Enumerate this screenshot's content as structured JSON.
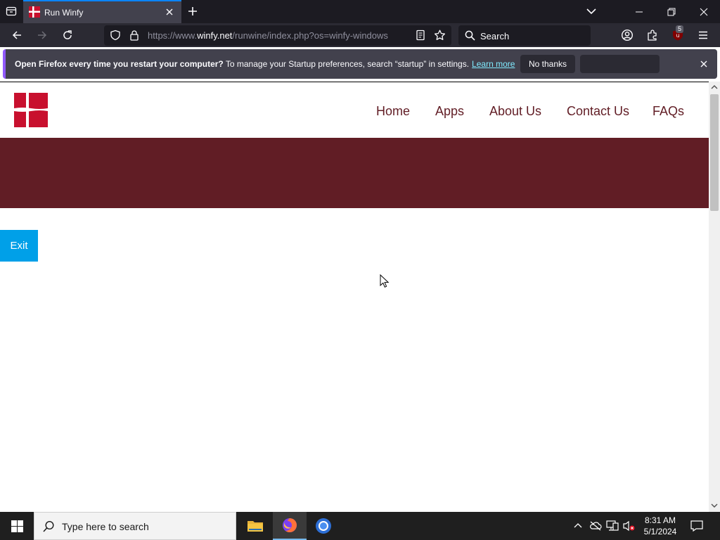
{
  "browser": {
    "tab_title": "Run Winfy",
    "url_prefix": "https://www.",
    "url_domain": "winfy.net",
    "url_rest": "/runwine/index.php?os=winfy-windows",
    "search_placeholder": "Search",
    "extension_badge": "5"
  },
  "notification": {
    "bold_text": "Open Firefox every time you restart your computer?",
    "text": " To manage your Startup preferences, search “startup” in settings.",
    "link": "Learn more",
    "primary_button": "No thanks"
  },
  "site": {
    "nav": [
      "Home",
      "Apps",
      "About Us",
      "Contact Us",
      "FAQs"
    ],
    "exit_button": "Exit",
    "brand_color": "#611d25",
    "accent_color": "#00a0e8"
  },
  "taskbar": {
    "search_placeholder": "Type here to search",
    "time": "8:31 AM",
    "date": "5/1/2024"
  }
}
